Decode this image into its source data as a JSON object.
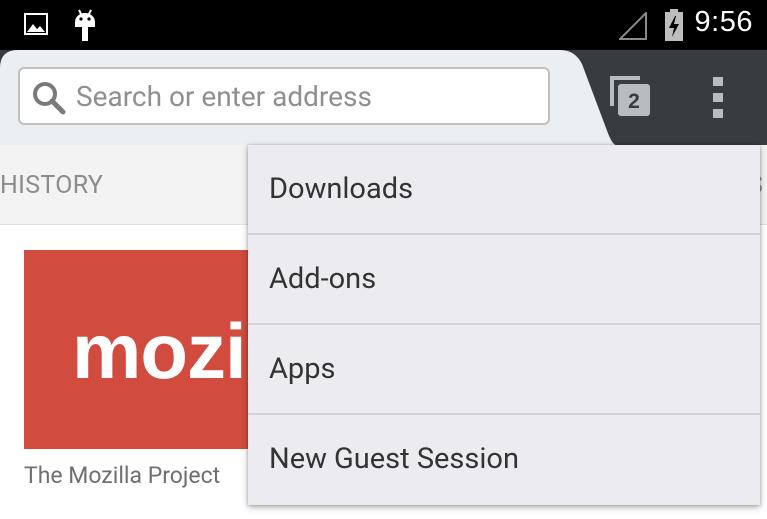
{
  "status_bar": {
    "time": "9:56",
    "icons": [
      "picture-icon",
      "android-icon",
      "signal-icon",
      "battery-charging-icon"
    ]
  },
  "toolbar": {
    "search_placeholder": "Search or enter address",
    "tab_count": "2",
    "menu_icon": "overflow-menu-icon"
  },
  "panels": {
    "history_label": "HISTORY",
    "next_label_fragment": "S"
  },
  "top_sites": [
    {
      "logo_text": "mozilla",
      "label": "The Mozilla Project"
    }
  ],
  "menu": {
    "items": [
      {
        "label": "Downloads"
      },
      {
        "label": "Add-ons"
      },
      {
        "label": "Apps"
      },
      {
        "label": "New Guest Session"
      }
    ]
  },
  "colors": {
    "toolbar": "#383b3f",
    "url_tab": "#eceff2",
    "mozilla_tile": "#d14c3f",
    "menu_bg": "#ececf0"
  }
}
